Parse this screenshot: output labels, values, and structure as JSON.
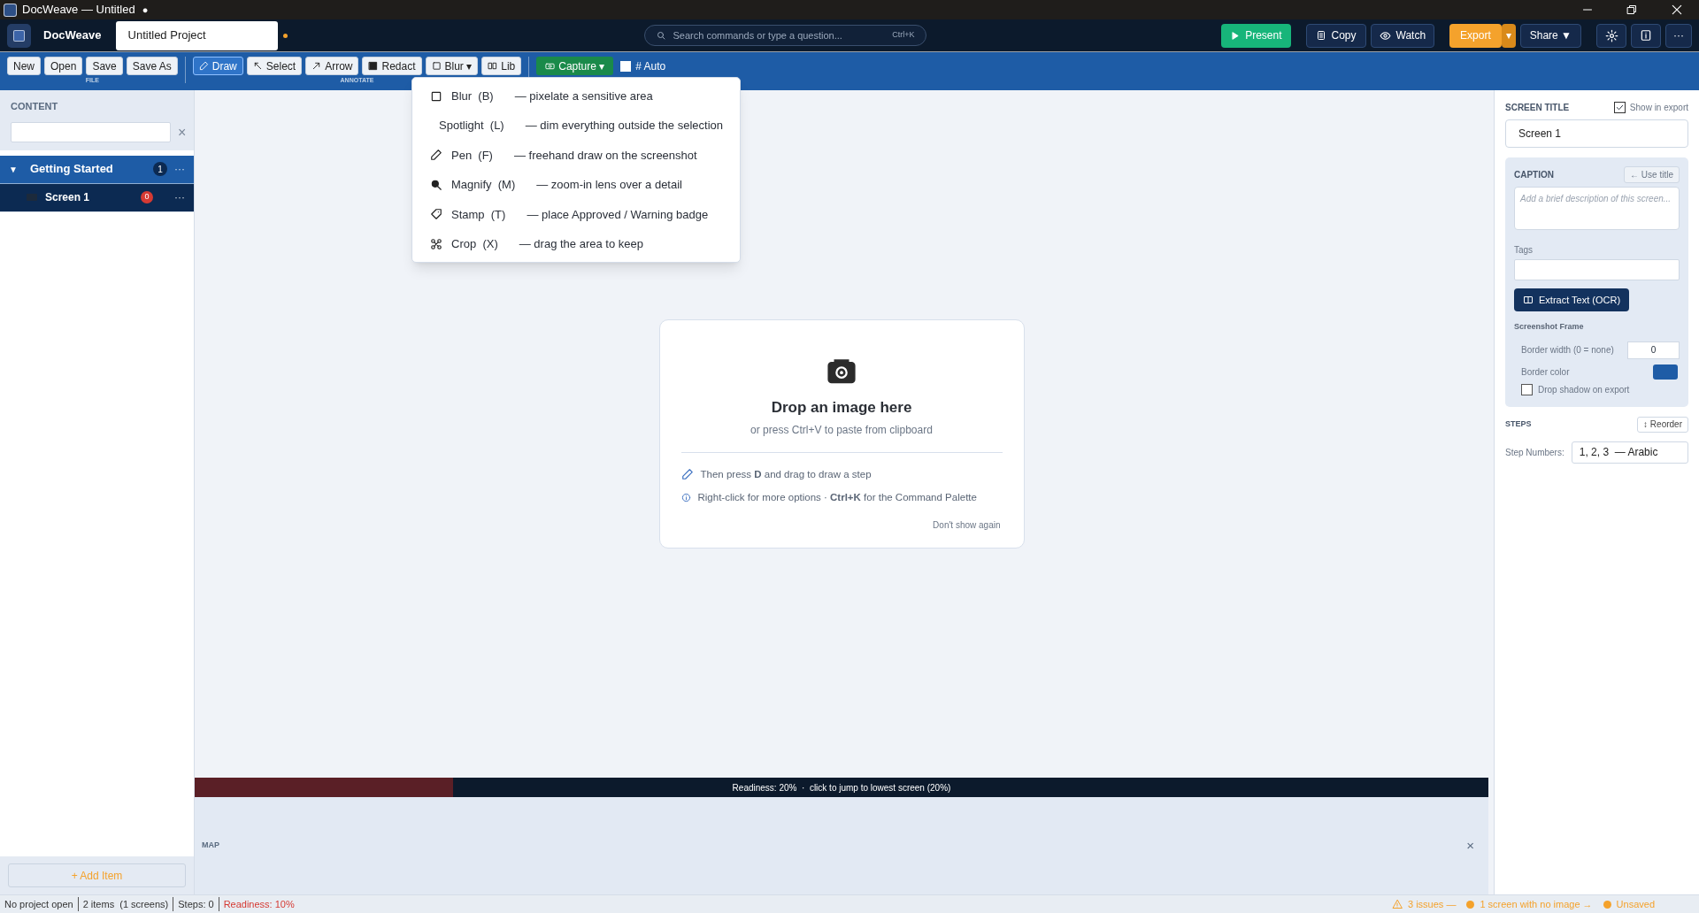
{
  "window": {
    "title": "DocWeave — Untitled",
    "unsaved_mark": "●"
  },
  "header": {
    "app_name": "DocWeave",
    "project_name": "Untitled Project",
    "modified": true,
    "search": {
      "placeholder": "Search commands or type a question...",
      "shortcut": "Ctrl+K"
    },
    "actions": [
      {
        "kind": "present",
        "label": "Present"
      },
      {
        "kind": "copy",
        "label": "Copy"
      },
      {
        "kind": "watch",
        "label": "Watch"
      },
      {
        "kind": "export",
        "label": "Export"
      },
      {
        "kind": "export-caret",
        "label": "▾"
      },
      {
        "kind": "share",
        "label": "Share ▼"
      },
      {
        "kind": "settings"
      },
      {
        "kind": "info"
      },
      {
        "kind": "more",
        "label": "···"
      }
    ]
  },
  "toolbar": {
    "groups": [
      {
        "label": "FILE",
        "buttons": [
          {
            "label": "New",
            "kind": "plain",
            "selected": false
          },
          {
            "label": "Open",
            "kind": "plain",
            "selected": false
          },
          {
            "label": "Save",
            "kind": "plain",
            "selected": false
          },
          {
            "label": "Save As",
            "kind": "plain",
            "selected": false
          }
        ]
      },
      {
        "label": "ANNOTATE",
        "buttons": [
          {
            "label": "Draw",
            "kind": "draw",
            "selected": true
          },
          {
            "label": "Select",
            "kind": "select",
            "selected": false
          },
          {
            "label": "Arrow",
            "kind": "arrow",
            "selected": false
          },
          {
            "label": "Redact",
            "kind": "redact",
            "selected": false
          },
          {
            "label": "Blur ▾",
            "kind": "blur",
            "selected": false
          },
          {
            "label": "Lib",
            "kind": "lib",
            "selected": false
          }
        ]
      }
    ],
    "capture": {
      "label": "Capture ▾"
    },
    "auto": {
      "label": "# Auto",
      "checked": false
    }
  },
  "tool_menu": [
    {
      "kind": "blur",
      "label": "Blur",
      "key": "(B)",
      "description": "— pixelate a sensitive area"
    },
    {
      "kind": "spotlight",
      "label": "Spotlight",
      "key": "(L)",
      "description": "— dim everything outside the selection"
    },
    {
      "kind": "pen",
      "label": "Pen",
      "key": "(F)",
      "description": "— freehand draw on the screenshot"
    },
    {
      "kind": "magnify",
      "label": "Magnify",
      "key": "(M)",
      "description": "— zoom-in lens over a detail"
    },
    {
      "kind": "stamp",
      "label": "Stamp",
      "key": "(T)",
      "description": "— place Approved / Warning badge"
    },
    {
      "kind": "crop",
      "label": "Crop",
      "key": "(X)",
      "description": "— drag the area to keep"
    }
  ],
  "sidebar": {
    "title": "CONTENT",
    "clear": "×",
    "tree": [
      {
        "toggle": "▼",
        "label": "Getting Started",
        "count": "1",
        "expanded": true,
        "selected": false,
        "more": "···",
        "children": [
          {
            "label": "Screen 1",
            "count": "0",
            "selected": true,
            "more": "···"
          }
        ]
      }
    ],
    "add_item": "+ Add Item"
  },
  "canvas": {
    "drop": {
      "title": "Drop an image here",
      "subtitle": "or press Ctrl+V to paste from clipboard",
      "hints": [
        {
          "kind": "pencil",
          "text": "Then press **D** and drag to draw a step"
        },
        {
          "kind": "info",
          "text": "Right-click for more options · **Ctrl+K** for the Command Palette"
        }
      ],
      "dismiss": "Don't show again"
    },
    "readiness": {
      "level": 0.2,
      "text": "Readiness: 20%  ·  click to jump to lowest screen (20%)"
    },
    "map": {
      "label": "MAP",
      "close": "×"
    }
  },
  "inspector": {
    "screen_title": {
      "label": "SCREEN TITLE",
      "show_in_export": {
        "label": "Show in export",
        "checked": true
      },
      "value": "Screen 1"
    },
    "caption": {
      "label": "CAPTION",
      "use_title": "← Use title",
      "placeholder": "Add a brief description of this screen..."
    },
    "tags": {
      "label": "Tags"
    },
    "ocr_button": "Extract Text (OCR)",
    "frame": {
      "heading": "Screenshot Frame",
      "border_width": {
        "label": "Border width (0 = none)",
        "value": "0"
      },
      "border_color": {
        "label": "Border color",
        "color": "#1e5ca6"
      },
      "drop_shadow": {
        "label": "Drop shadow on export",
        "checked": false
      }
    },
    "steps": {
      "label": "STEPS",
      "reorder": "↕ Reorder",
      "numbers_label": "Step Numbers:",
      "numbers_value": "1, 2, 3  — Arabic"
    }
  },
  "status_bar": {
    "items": [
      "No project open",
      "2 items  (1 screens)",
      "Steps: 0"
    ],
    "readiness": "Readiness: 10%",
    "alerts": [
      {
        "kind": "warning",
        "text": "3 issues —"
      },
      {
        "kind": "dot",
        "text": "1 screen with no image →"
      },
      {
        "kind": "dot",
        "text": "Unsaved"
      }
    ]
  }
}
